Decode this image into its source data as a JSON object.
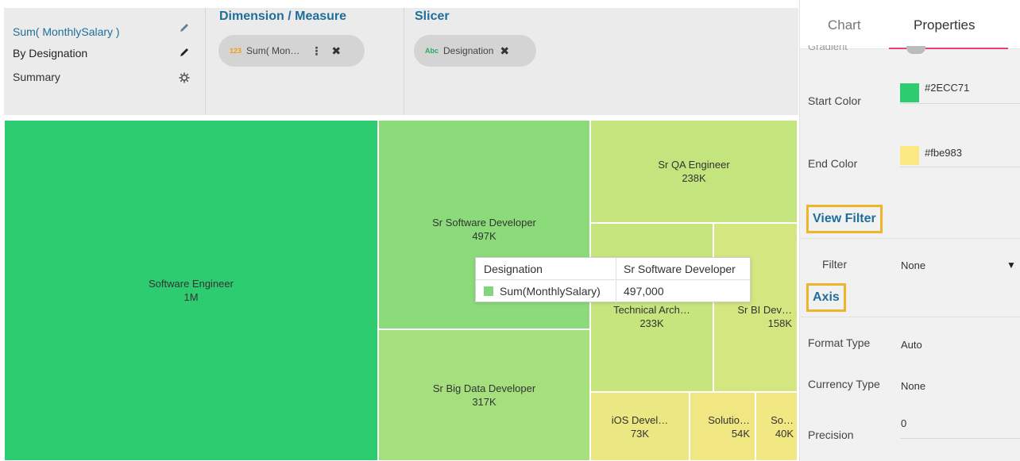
{
  "sidebar_menu": {
    "items": [
      {
        "label": "Sum( MonthlySalary )",
        "icon": "pencil-icon"
      },
      {
        "label": "By Designation",
        "icon": "pencil-icon"
      },
      {
        "label": "Summary",
        "icon": "gear-icon"
      }
    ]
  },
  "dimension_measure": {
    "title": "Dimension / Measure",
    "chip": {
      "type_tag": "123",
      "label": "Sum( Mon…"
    }
  },
  "slicer": {
    "title": "Slicer",
    "chip": {
      "type_tag": "Abc",
      "label": "Designation"
    }
  },
  "treemap": {
    "tiles": [
      {
        "label": "Software Engineer",
        "value": "1M",
        "color": "#2ecc71"
      },
      {
        "label": "Sr Software Developer",
        "value": "497K",
        "color": "#8bdb7a"
      },
      {
        "label": "Sr Big Data Developer",
        "value": "317K",
        "color": "#a6e07e"
      },
      {
        "label": "Sr QA Engineer",
        "value": "238K",
        "color": "#c4e57e"
      },
      {
        "label": "Technical Arch…",
        "value": "233K",
        "color": "#c6e57d"
      },
      {
        "label": "Sr BI Dev…",
        "value": "158K",
        "color": "#d4e67f"
      },
      {
        "label": "iOS Devel…",
        "value": "73K",
        "color": "#ebe782"
      },
      {
        "label": "Solutio…",
        "value": "54K",
        "color": "#f0e783"
      },
      {
        "label": "So…",
        "value": "40K",
        "color": "#f2e883"
      }
    ]
  },
  "tooltip": {
    "header_key": "Designation",
    "header_value": "Sr Software Developer",
    "row_key": "Sum(MonthlySalary)",
    "row_value": "497,000",
    "swatch_color": "#7fd67d"
  },
  "right_panel": {
    "tabs": [
      "Chart",
      "Properties"
    ],
    "active_tab": "Properties",
    "cut_label": "Gradient",
    "start_color": {
      "label": "Start Color",
      "value": "#2ECC71"
    },
    "end_color": {
      "label": "End Color",
      "value": "#fbe983"
    },
    "view_filter": {
      "title": "View Filter",
      "filter_label": "Filter",
      "filter_value": "None"
    },
    "axis": {
      "title": "Axis",
      "format_type_label": "Format Type",
      "format_type_value": "Auto",
      "currency_type_label": "Currency Type",
      "currency_type_value": "None",
      "precision_label": "Precision",
      "precision_value": "0"
    }
  }
}
